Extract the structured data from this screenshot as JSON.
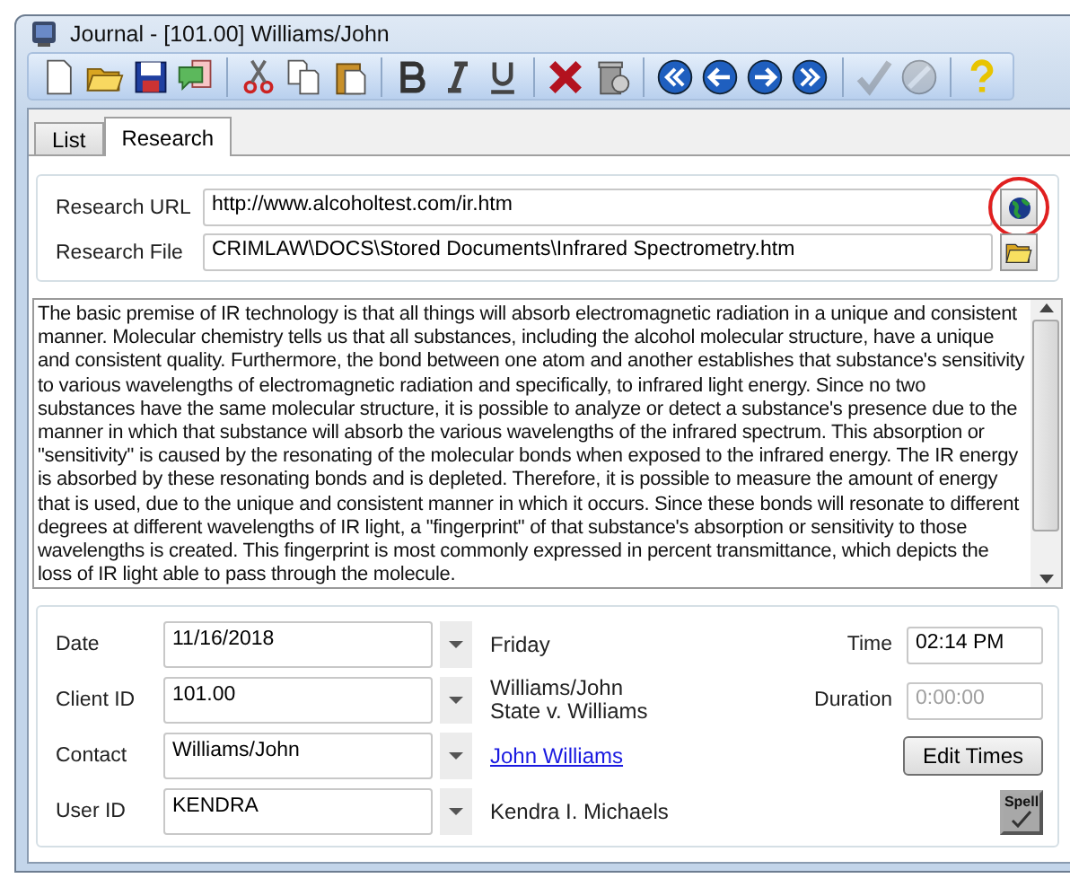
{
  "window": {
    "title": "Journal - [101.00] Williams/John"
  },
  "toolbar": [
    [
      {
        "kind": "new",
        "disabled": false
      },
      {
        "kind": "open",
        "disabled": false
      },
      {
        "kind": "save",
        "disabled": false
      },
      {
        "kind": "note",
        "disabled": false
      }
    ],
    [
      {
        "kind": "cut",
        "disabled": false
      },
      {
        "kind": "copy",
        "disabled": false
      },
      {
        "kind": "paste",
        "disabled": false
      }
    ],
    [
      {
        "kind": "bold",
        "disabled": false
      },
      {
        "kind": "italic",
        "disabled": false
      },
      {
        "kind": "underline",
        "disabled": false
      }
    ],
    [
      {
        "kind": "delete",
        "disabled": false
      },
      {
        "kind": "trash",
        "disabled": false
      }
    ],
    [
      {
        "kind": "first",
        "disabled": false
      },
      {
        "kind": "previous",
        "disabled": false
      },
      {
        "kind": "next",
        "disabled": false
      },
      {
        "kind": "last",
        "disabled": false
      }
    ],
    [
      {
        "kind": "check",
        "disabled": true
      },
      {
        "kind": "cancel",
        "disabled": true
      }
    ],
    [
      {
        "kind": "help",
        "disabled": false
      }
    ]
  ],
  "tabs": [
    {
      "label": "List",
      "selected": false
    },
    {
      "label": "Research",
      "selected": true
    }
  ],
  "research": {
    "url_label": "Research URL",
    "url": "http://www.alcoholtest.com/ir.htm",
    "file_label": "Research File",
    "file": "CRIMLAW\\DOCS\\Stored Documents\\Infrared Spectrometry.htm"
  },
  "notes": "The basic premise of IR technology is that all things will absorb electromagnetic radiation in a unique and consistent manner. Molecular chemistry tells us that all substances, including the alcohol molecular structure, have a unique and consistent quality. Furthermore, the bond between one atom and another establishes that substance's sensitivity to various wavelengths of electromagnetic radiation and specifically, to infrared light energy. Since no two substances have the same molecular structure, it is possible to analyze or detect a substance's presence due to the manner in which that substance will absorb the various wavelengths of the infrared spectrum. This absorption or \"sensitivity\" is caused by the resonating of the molecular bonds when exposed to the infrared energy. The IR energy is absorbed by these resonating bonds and is depleted. Therefore, it is possible to measure the amount of energy that is used, due to the unique and consistent manner in which it occurs. Since these bonds will resonate to different degrees at different wavelengths of IR light, a \"fingerprint\" of that substance's absorption or sensitivity to those wavelengths is created. This fingerprint is most commonly expressed in percent transmittance, which depicts the loss of IR light able to pass through the molecule.",
  "fields": [
    {
      "label": "Date",
      "value": "11/16/2018",
      "kind": "text",
      "info": [
        "Friday"
      ]
    },
    {
      "label": "Client ID",
      "value": "101.00",
      "kind": "text",
      "info": [
        "Williams/John",
        "State v. Williams"
      ]
    },
    {
      "label": "Contact",
      "value": "Williams/John",
      "kind": "link",
      "info": [
        "John Williams"
      ]
    },
    {
      "label": "User ID",
      "value": "KENDRA",
      "kind": "text",
      "info": [
        "Kendra I. Michaels"
      ]
    }
  ],
  "times": [
    {
      "label": "Time",
      "value": "02:14 PM",
      "disabled": false
    },
    {
      "label": "Duration",
      "value": "0:00:00",
      "disabled": true
    }
  ],
  "edit_times_button": "Edit Times",
  "spell_button": "Spell"
}
